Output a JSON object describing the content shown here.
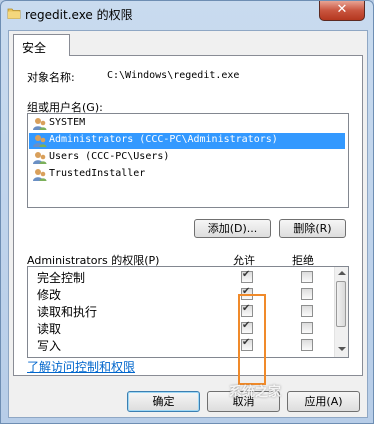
{
  "window": {
    "title": "regedit.exe 的权限",
    "close_label": "✕"
  },
  "tab": {
    "label": "安全"
  },
  "object": {
    "label": "对象名称:",
    "value": "C:\\Windows\\regedit.exe"
  },
  "group_section": {
    "label": "组或用户名(G):"
  },
  "groups": [
    {
      "name": "SYSTEM",
      "selected": false
    },
    {
      "name": "Administrators (CCC-PC\\Administrators)",
      "selected": true
    },
    {
      "name": "Users (CCC-PC\\Users)",
      "selected": false
    },
    {
      "name": "TrustedInstaller",
      "selected": false
    }
  ],
  "buttons": {
    "add": "添加(D)...",
    "remove": "删除(R)",
    "ok": "确定",
    "cancel": "取消",
    "apply": "应用(A)"
  },
  "permissions": {
    "title": "Administrators 的权限(P)",
    "allow_header": "允许",
    "deny_header": "拒绝",
    "rows": [
      {
        "name": "完全控制",
        "allow": true,
        "deny": false
      },
      {
        "name": "修改",
        "allow": true,
        "deny": false
      },
      {
        "name": "读取和执行",
        "allow": true,
        "deny": false
      },
      {
        "name": "读取",
        "allow": true,
        "deny": false
      },
      {
        "name": "写入",
        "allow": true,
        "deny": false
      }
    ]
  },
  "link": {
    "text": "了解访问控制和权限"
  },
  "watermark": {
    "text": "系统之家"
  },
  "colors": {
    "selection": "#3399ff",
    "highlight_box": "#f08a2a",
    "link": "#0066cc"
  }
}
